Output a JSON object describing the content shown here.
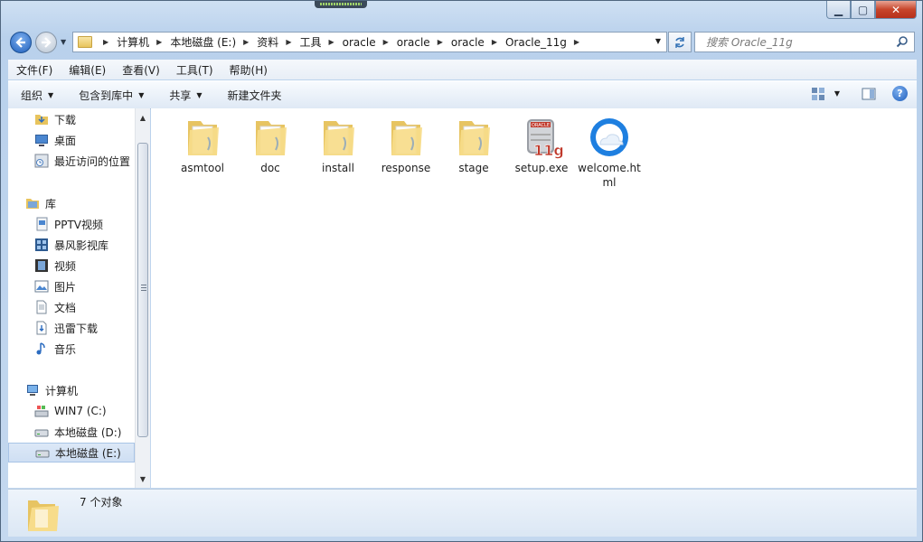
{
  "window": {
    "caption_buttons": {
      "minimize": "▁",
      "maximize": "▢",
      "close": "✕"
    }
  },
  "address_bar": {
    "breadcrumbs": [
      "计算机",
      "本地磁盘 (E:)",
      "资料",
      "工具",
      "oracle",
      "oracle",
      "oracle",
      "Oracle_11g"
    ]
  },
  "search": {
    "placeholder": "搜索 Oracle_11g"
  },
  "menubar": {
    "items": [
      "文件(F)",
      "编辑(E)",
      "查看(V)",
      "工具(T)",
      "帮助(H)"
    ]
  },
  "toolbar": {
    "organize": "组织",
    "include_in_library": "包含到库中",
    "share": "共享",
    "new_folder": "新建文件夹"
  },
  "sidebar": {
    "favorites": [
      {
        "label": "下载",
        "icon": "download-folder-icon"
      },
      {
        "label": "桌面",
        "icon": "desktop-icon"
      },
      {
        "label": "最近访问的位置",
        "icon": "recent-places-icon"
      }
    ],
    "libraries_header": "库",
    "libraries": [
      {
        "label": "PPTV视频",
        "icon": "video-library-icon"
      },
      {
        "label": "暴风影视库",
        "icon": "media-library-icon"
      },
      {
        "label": "视频",
        "icon": "film-icon"
      },
      {
        "label": "图片",
        "icon": "picture-icon"
      },
      {
        "label": "文档",
        "icon": "document-icon"
      },
      {
        "label": "迅雷下载",
        "icon": "download-library-icon"
      },
      {
        "label": "音乐",
        "icon": "music-icon"
      }
    ],
    "computer_header": "计算机",
    "drives": [
      {
        "label": "WIN7 (C:)",
        "icon": "system-drive-icon"
      },
      {
        "label": "本地磁盘 (D:)",
        "icon": "drive-icon"
      },
      {
        "label": "本地磁盘 (E:)",
        "icon": "drive-icon",
        "selected": true
      }
    ]
  },
  "files": [
    {
      "name": "asmtool",
      "type": "folder"
    },
    {
      "name": "doc",
      "type": "folder"
    },
    {
      "name": "install",
      "type": "folder"
    },
    {
      "name": "response",
      "type": "folder"
    },
    {
      "name": "stage",
      "type": "folder"
    },
    {
      "name": "setup.exe",
      "type": "oracle-installer"
    },
    {
      "name": "welcome.html",
      "type": "html"
    }
  ],
  "installer_badge": "11g",
  "installer_brand": "ORACLE",
  "status_bar": {
    "count_text": "7 个对象"
  },
  "colors": {
    "accent": "#1f5fbc",
    "selection": "#cfdff3",
    "close_button": "#c7452b"
  }
}
